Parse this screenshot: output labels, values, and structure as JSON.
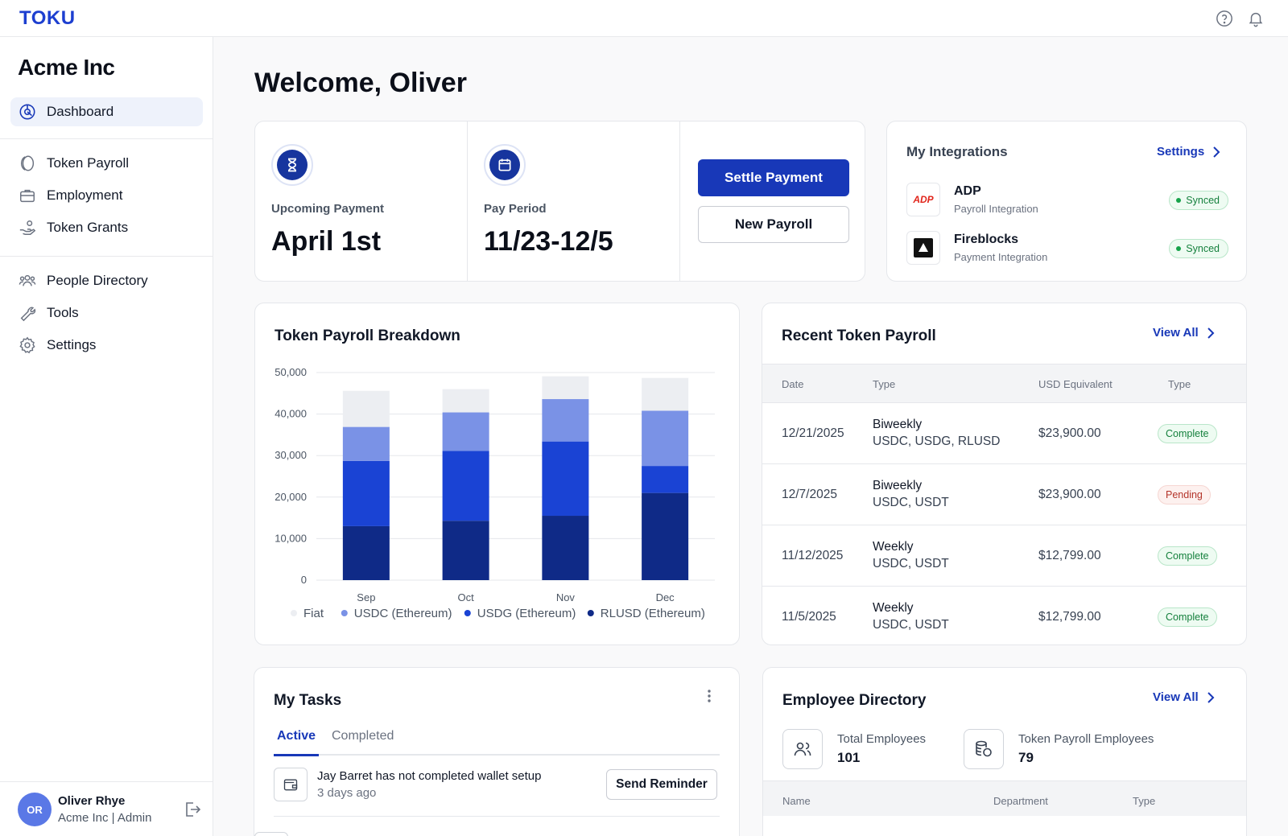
{
  "app": {
    "logo": "TOKU"
  },
  "sidebar": {
    "org_name": "Acme Inc",
    "items": [
      {
        "label": "Dashboard",
        "icon": "dashboard-icon"
      },
      {
        "label": "Token Payroll",
        "icon": "coin-icon"
      },
      {
        "label": "Employment",
        "icon": "briefcase-icon"
      },
      {
        "label": "Token Grants",
        "icon": "hand-coins-icon"
      },
      {
        "label": "People Directory",
        "icon": "people-icon"
      },
      {
        "label": "Tools",
        "icon": "wrench-icon"
      },
      {
        "label": "Settings",
        "icon": "gear-icon"
      }
    ],
    "user": {
      "initials": "OR",
      "name": "Oliver Rhye",
      "role": "Acme Inc | Admin"
    }
  },
  "main": {
    "welcome": "Welcome, Oliver",
    "upcoming": {
      "label": "Upcoming Payment",
      "value": "April 1st"
    },
    "pay_period": {
      "label": "Pay Period",
      "value": "11/23-12/5"
    },
    "actions": {
      "settle": "Settle Payment",
      "new_payroll": "New Payroll"
    },
    "integrations": {
      "title": "My Integrations",
      "settings_link": "Settings",
      "items": [
        {
          "name": "ADP",
          "sub": "Payroll Integration",
          "status": "Synced",
          "logo_text": "ADP"
        },
        {
          "name": "Fireblocks",
          "sub": "Payment Integration",
          "status": "Synced"
        }
      ]
    },
    "breakdown": {
      "title": "Token Payroll Breakdown"
    },
    "recent": {
      "title": "Recent Token Payroll",
      "view_all": "View All",
      "headers": [
        "Date",
        "Type",
        "USD Equivalent",
        "Type"
      ],
      "rows": [
        {
          "date": "12/21/2025",
          "type": "Biweekly",
          "tokens": "USDC, USDG, RLUSD",
          "usd": "$23,900.00",
          "status": "Complete"
        },
        {
          "date": "12/7/2025",
          "type": "Biweekly",
          "tokens": "USDC, USDT",
          "usd": "$23,900.00",
          "status": "Pending"
        },
        {
          "date": "11/12/2025",
          "type": "Weekly",
          "tokens": "USDC, USDT",
          "usd": "$12,799.00",
          "status": "Complete"
        },
        {
          "date": "11/5/2025",
          "type": "Weekly",
          "tokens": "USDC, USDT",
          "usd": "$12,799.00",
          "status": "Complete"
        }
      ]
    },
    "tasks": {
      "title": "My Tasks",
      "tabs": [
        "Active",
        "Completed"
      ],
      "items": [
        {
          "text": "Jay Barret has not completed wallet setup",
          "sub": "3 days ago",
          "action": "Send Reminder"
        }
      ]
    },
    "employees": {
      "title": "Employee Directory",
      "view_all": "View All",
      "total_label": "Total Employees",
      "total_value": "101",
      "token_label": "Token Payroll Employees",
      "token_value": "79",
      "headers": [
        "Name",
        "Department",
        "Type"
      ]
    }
  },
  "chart_data": {
    "type": "bar",
    "stacked": true,
    "categories": [
      "Sep",
      "Oct",
      "Nov",
      "Dec"
    ],
    "series": [
      {
        "name": "RLUSD (Ethereum)",
        "color": "#0f2a87",
        "values": [
          13000,
          14300,
          15500,
          21000
        ]
      },
      {
        "name": "USDG (Ethereum)",
        "color": "#1a43d4",
        "values": [
          15700,
          16800,
          17900,
          6500
        ]
      },
      {
        "name": "USDC (Ethereum)",
        "color": "#7a92e6",
        "values": [
          8200,
          9300,
          10200,
          13300
        ]
      },
      {
        "name": "Fiat",
        "color": "#eceef2",
        "values": [
          8700,
          5600,
          5500,
          7900
        ]
      }
    ],
    "legend_order": [
      "Fiat",
      "USDC (Ethereum)",
      "USDG (Ethereum)",
      "RLUSD (Ethereum)"
    ],
    "y_ticks": [
      "0",
      "10,000",
      "20,000",
      "30,000",
      "40,000",
      "50,000"
    ],
    "ylim": [
      0,
      50000
    ],
    "grid": true,
    "legend": "bottom"
  }
}
